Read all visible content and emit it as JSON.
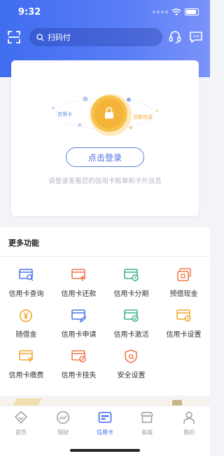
{
  "status_bar": {
    "time": "9:32"
  },
  "search": {
    "placeholder": "扫码付"
  },
  "card": {
    "tag_left": "信用卡",
    "tag_right": "还款信息",
    "login_button": "点击登录",
    "hint": "请登录查看您的信用卡账单和卡片信息"
  },
  "more": {
    "title": "更多功能",
    "items": [
      {
        "label": "信用卡查询",
        "icon": "card-search-icon",
        "color": "#4a76e8"
      },
      {
        "label": "信用卡还款",
        "icon": "card-repay-icon",
        "color": "#ee7a4a"
      },
      {
        "label": "信用卡分期",
        "icon": "card-installment-icon",
        "color": "#3db38a"
      },
      {
        "label": "预借现金",
        "icon": "cash-advance-icon",
        "color": "#ee7a4a"
      },
      {
        "label": "随借金",
        "icon": "yen-coin-icon",
        "color": "#f0a830"
      },
      {
        "label": "信用卡申请",
        "icon": "card-apply-icon",
        "color": "#4a76e8"
      },
      {
        "label": "信用卡激活",
        "icon": "card-activate-icon",
        "color": "#3db38a"
      },
      {
        "label": "信用卡设置",
        "icon": "card-settings-icon",
        "color": "#f0a830"
      },
      {
        "label": "信用卡缴费",
        "icon": "card-payment-icon",
        "color": "#f0a830"
      },
      {
        "label": "信用卡挂失",
        "icon": "card-lost-icon",
        "color": "#ee7a4a"
      },
      {
        "label": "安全设置",
        "icon": "security-shield-icon",
        "color": "#ee7a4a"
      }
    ]
  },
  "tabbar": {
    "active_color": "#3f6df0",
    "items": [
      {
        "label": "首页",
        "icon": "home-icon"
      },
      {
        "label": "理财",
        "icon": "wealth-trend-icon"
      },
      {
        "label": "信用卡",
        "icon": "credit-card-icon"
      },
      {
        "label": "商城",
        "icon": "mall-icon"
      },
      {
        "label": "我的",
        "icon": "profile-icon"
      }
    ]
  }
}
